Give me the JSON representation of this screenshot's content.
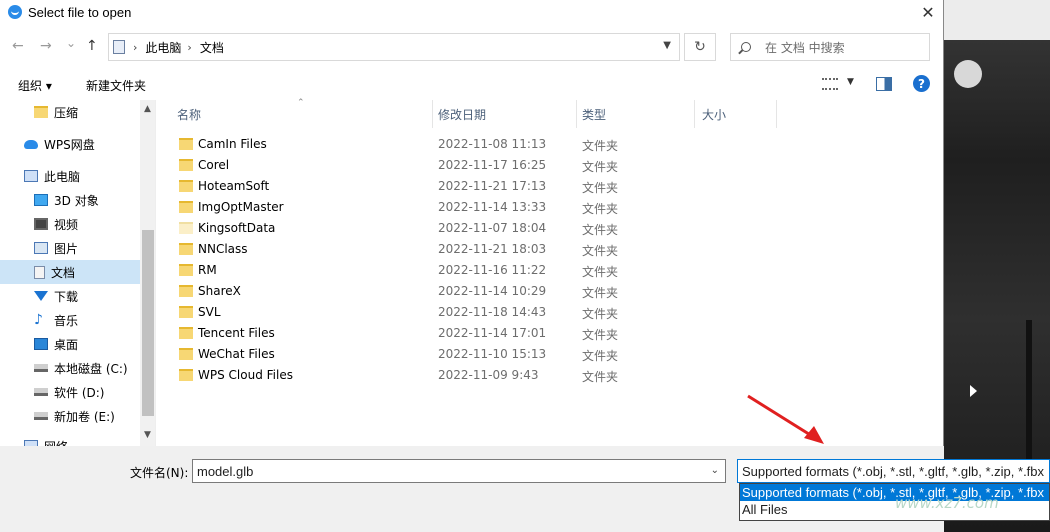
{
  "window": {
    "title": "Select file to open",
    "close": "✕"
  },
  "nav": {
    "back": "←",
    "forward": "→",
    "recent": "⌄",
    "up": "↑",
    "breadcrumb": [
      "此电脑",
      "文档"
    ],
    "refresh": "↻",
    "search_placeholder": "在 文档 中搜索"
  },
  "toolbar": {
    "organize": "组织 ▾",
    "new_folder": "新建文件夹",
    "help": "?"
  },
  "sidebar": {
    "items": [
      {
        "label": "压缩",
        "icon": "folder-icon"
      },
      {
        "label": "WPS网盘",
        "icon": "cloud-icon"
      },
      {
        "label": "此电脑",
        "icon": "computer-icon"
      },
      {
        "label": "3D 对象",
        "icon": "cube-icon"
      },
      {
        "label": "视频",
        "icon": "video-icon"
      },
      {
        "label": "图片",
        "icon": "picture-icon"
      },
      {
        "label": "文档",
        "icon": "document-icon",
        "selected": true
      },
      {
        "label": "下载",
        "icon": "download-icon"
      },
      {
        "label": "音乐",
        "icon": "music-icon"
      },
      {
        "label": "桌面",
        "icon": "desktop-icon"
      },
      {
        "label": "本地磁盘 (C:)",
        "icon": "drive-icon"
      },
      {
        "label": "软件 (D:)",
        "icon": "drive-icon"
      },
      {
        "label": "新加卷 (E:)",
        "icon": "drive-icon"
      },
      {
        "label": "网络",
        "icon": "network-icon"
      }
    ]
  },
  "columns": {
    "name": "名称",
    "date": "修改日期",
    "type": "类型",
    "size": "大小"
  },
  "files": [
    {
      "name": "CamIn Files",
      "date": "2022-11-08 11:13",
      "type": "文件夹"
    },
    {
      "name": "Corel",
      "date": "2022-11-17 16:25",
      "type": "文件夹"
    },
    {
      "name": "HoteamSoft",
      "date": "2022-11-21 17:13",
      "type": "文件夹"
    },
    {
      "name": "ImgOptMaster",
      "date": "2022-11-14 13:33",
      "type": "文件夹"
    },
    {
      "name": "KingsoftData",
      "date": "2022-11-07 18:04",
      "type": "文件夹"
    },
    {
      "name": "NNClass",
      "date": "2022-11-21 18:03",
      "type": "文件夹"
    },
    {
      "name": "RM",
      "date": "2022-11-16 11:22",
      "type": "文件夹"
    },
    {
      "name": "ShareX",
      "date": "2022-11-14 10:29",
      "type": "文件夹"
    },
    {
      "name": "SVL",
      "date": "2022-11-18 14:43",
      "type": "文件夹"
    },
    {
      "name": "Tencent Files",
      "date": "2022-11-14 17:01",
      "type": "文件夹"
    },
    {
      "name": "WeChat Files",
      "date": "2022-11-10 15:13",
      "type": "文件夹"
    },
    {
      "name": "WPS Cloud Files",
      "date": "2022-11-09 9:43",
      "type": "文件夹"
    }
  ],
  "bottom": {
    "filename_label": "文件名(N):",
    "filename_value": "model.glb",
    "filetype_selected": "Supported formats (*.obj, *.stl, *.gltf, *.glb, *.zip, *.fbx",
    "filetype_options": [
      "Supported formats (*.obj, *.stl, *.gltf, *.glb, *.zip, *.fbx",
      "All Files"
    ]
  },
  "watermark": "www.xz7.com",
  "colors": {
    "accent": "#0078d7",
    "selected_bg": "#cce4f7",
    "folder": "#f7d774",
    "annotation_arrow": "#e02020"
  }
}
